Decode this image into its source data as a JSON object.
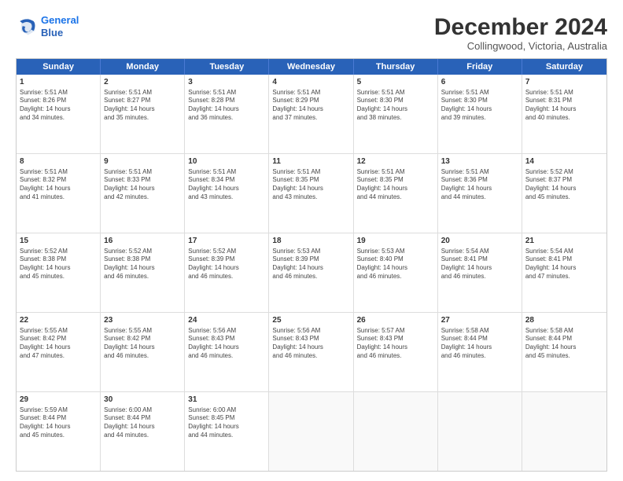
{
  "logo": {
    "line1": "General",
    "line2": "Blue"
  },
  "title": "December 2024",
  "subtitle": "Collingwood, Victoria, Australia",
  "days": [
    "Sunday",
    "Monday",
    "Tuesday",
    "Wednesday",
    "Thursday",
    "Friday",
    "Saturday"
  ],
  "rows": [
    [
      {
        "day": "1",
        "lines": [
          "Sunrise: 5:51 AM",
          "Sunset: 8:26 PM",
          "Daylight: 14 hours",
          "and 34 minutes."
        ]
      },
      {
        "day": "2",
        "lines": [
          "Sunrise: 5:51 AM",
          "Sunset: 8:27 PM",
          "Daylight: 14 hours",
          "and 35 minutes."
        ]
      },
      {
        "day": "3",
        "lines": [
          "Sunrise: 5:51 AM",
          "Sunset: 8:28 PM",
          "Daylight: 14 hours",
          "and 36 minutes."
        ]
      },
      {
        "day": "4",
        "lines": [
          "Sunrise: 5:51 AM",
          "Sunset: 8:29 PM",
          "Daylight: 14 hours",
          "and 37 minutes."
        ]
      },
      {
        "day": "5",
        "lines": [
          "Sunrise: 5:51 AM",
          "Sunset: 8:30 PM",
          "Daylight: 14 hours",
          "and 38 minutes."
        ]
      },
      {
        "day": "6",
        "lines": [
          "Sunrise: 5:51 AM",
          "Sunset: 8:30 PM",
          "Daylight: 14 hours",
          "and 39 minutes."
        ]
      },
      {
        "day": "7",
        "lines": [
          "Sunrise: 5:51 AM",
          "Sunset: 8:31 PM",
          "Daylight: 14 hours",
          "and 40 minutes."
        ]
      }
    ],
    [
      {
        "day": "8",
        "lines": [
          "Sunrise: 5:51 AM",
          "Sunset: 8:32 PM",
          "Daylight: 14 hours",
          "and 41 minutes."
        ]
      },
      {
        "day": "9",
        "lines": [
          "Sunrise: 5:51 AM",
          "Sunset: 8:33 PM",
          "Daylight: 14 hours",
          "and 42 minutes."
        ]
      },
      {
        "day": "10",
        "lines": [
          "Sunrise: 5:51 AM",
          "Sunset: 8:34 PM",
          "Daylight: 14 hours",
          "and 43 minutes."
        ]
      },
      {
        "day": "11",
        "lines": [
          "Sunrise: 5:51 AM",
          "Sunset: 8:35 PM",
          "Daylight: 14 hours",
          "and 43 minutes."
        ]
      },
      {
        "day": "12",
        "lines": [
          "Sunrise: 5:51 AM",
          "Sunset: 8:35 PM",
          "Daylight: 14 hours",
          "and 44 minutes."
        ]
      },
      {
        "day": "13",
        "lines": [
          "Sunrise: 5:51 AM",
          "Sunset: 8:36 PM",
          "Daylight: 14 hours",
          "and 44 minutes."
        ]
      },
      {
        "day": "14",
        "lines": [
          "Sunrise: 5:52 AM",
          "Sunset: 8:37 PM",
          "Daylight: 14 hours",
          "and 45 minutes."
        ]
      }
    ],
    [
      {
        "day": "15",
        "lines": [
          "Sunrise: 5:52 AM",
          "Sunset: 8:38 PM",
          "Daylight: 14 hours",
          "and 45 minutes."
        ]
      },
      {
        "day": "16",
        "lines": [
          "Sunrise: 5:52 AM",
          "Sunset: 8:38 PM",
          "Daylight: 14 hours",
          "and 46 minutes."
        ]
      },
      {
        "day": "17",
        "lines": [
          "Sunrise: 5:52 AM",
          "Sunset: 8:39 PM",
          "Daylight: 14 hours",
          "and 46 minutes."
        ]
      },
      {
        "day": "18",
        "lines": [
          "Sunrise: 5:53 AM",
          "Sunset: 8:39 PM",
          "Daylight: 14 hours",
          "and 46 minutes."
        ]
      },
      {
        "day": "19",
        "lines": [
          "Sunrise: 5:53 AM",
          "Sunset: 8:40 PM",
          "Daylight: 14 hours",
          "and 46 minutes."
        ]
      },
      {
        "day": "20",
        "lines": [
          "Sunrise: 5:54 AM",
          "Sunset: 8:41 PM",
          "Daylight: 14 hours",
          "and 46 minutes."
        ]
      },
      {
        "day": "21",
        "lines": [
          "Sunrise: 5:54 AM",
          "Sunset: 8:41 PM",
          "Daylight: 14 hours",
          "and 47 minutes."
        ]
      }
    ],
    [
      {
        "day": "22",
        "lines": [
          "Sunrise: 5:55 AM",
          "Sunset: 8:42 PM",
          "Daylight: 14 hours",
          "and 47 minutes."
        ]
      },
      {
        "day": "23",
        "lines": [
          "Sunrise: 5:55 AM",
          "Sunset: 8:42 PM",
          "Daylight: 14 hours",
          "and 46 minutes."
        ]
      },
      {
        "day": "24",
        "lines": [
          "Sunrise: 5:56 AM",
          "Sunset: 8:43 PM",
          "Daylight: 14 hours",
          "and 46 minutes."
        ]
      },
      {
        "day": "25",
        "lines": [
          "Sunrise: 5:56 AM",
          "Sunset: 8:43 PM",
          "Daylight: 14 hours",
          "and 46 minutes."
        ]
      },
      {
        "day": "26",
        "lines": [
          "Sunrise: 5:57 AM",
          "Sunset: 8:43 PM",
          "Daylight: 14 hours",
          "and 46 minutes."
        ]
      },
      {
        "day": "27",
        "lines": [
          "Sunrise: 5:58 AM",
          "Sunset: 8:44 PM",
          "Daylight: 14 hours",
          "and 46 minutes."
        ]
      },
      {
        "day": "28",
        "lines": [
          "Sunrise: 5:58 AM",
          "Sunset: 8:44 PM",
          "Daylight: 14 hours",
          "and 45 minutes."
        ]
      }
    ],
    [
      {
        "day": "29",
        "lines": [
          "Sunrise: 5:59 AM",
          "Sunset: 8:44 PM",
          "Daylight: 14 hours",
          "and 45 minutes."
        ]
      },
      {
        "day": "30",
        "lines": [
          "Sunrise: 6:00 AM",
          "Sunset: 8:44 PM",
          "Daylight: 14 hours",
          "and 44 minutes."
        ]
      },
      {
        "day": "31",
        "lines": [
          "Sunrise: 6:00 AM",
          "Sunset: 8:45 PM",
          "Daylight: 14 hours",
          "and 44 minutes."
        ]
      },
      null,
      null,
      null,
      null
    ]
  ]
}
